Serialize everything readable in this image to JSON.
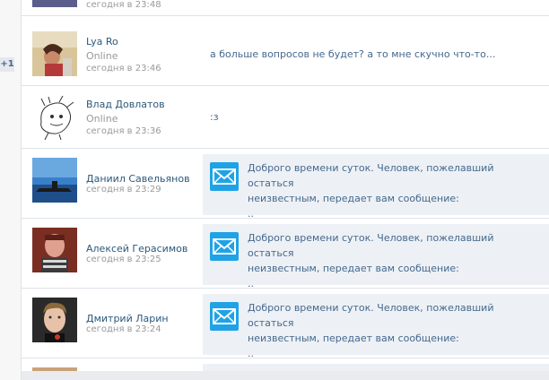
{
  "left_badge": "+1",
  "dialogs": [
    {
      "name": "",
      "status": "",
      "time": "сегодня в 23:48",
      "preview": ""
    },
    {
      "name": "Lya Ro",
      "status": "Online",
      "time": "сегодня в 23:46",
      "preview": "а больше вопросов не будет? а то мне скучно что-то..."
    },
    {
      "name": "Влад Довлатов",
      "status": "Online",
      "time": "сегодня в 23:36",
      "preview": ":з"
    },
    {
      "name": "Даниил Савельянов",
      "time": "сегодня в 23:29",
      "message_line1": "Доброго времени суток. Человек, пожелавший остаться",
      "message_line2": "неизвестным, передает вам сообщение:",
      "message_line3": ".."
    },
    {
      "name": "Алексей Герасимов",
      "time": "сегодня в 23:25",
      "message_line1": "Доброго времени суток. Человек, пожелавший остаться",
      "message_line2": "неизвестным, передает вам сообщение:",
      "message_line3": ".."
    },
    {
      "name": "Дмитрий Ларин",
      "time": "сегодня в 23:24",
      "message_line1": "Доброго времени суток. Человек, пожелавший остаться",
      "message_line2": "неизвестным, передает вам сообщение:",
      "message_line3": ".."
    }
  ],
  "icons": {
    "message": "envelope-icon"
  },
  "colors": {
    "link": "#2b587a",
    "text": "#45688e",
    "muted": "#999999",
    "message_bg": "#edf1f5",
    "envelope_bg": "#1fa3e6"
  }
}
